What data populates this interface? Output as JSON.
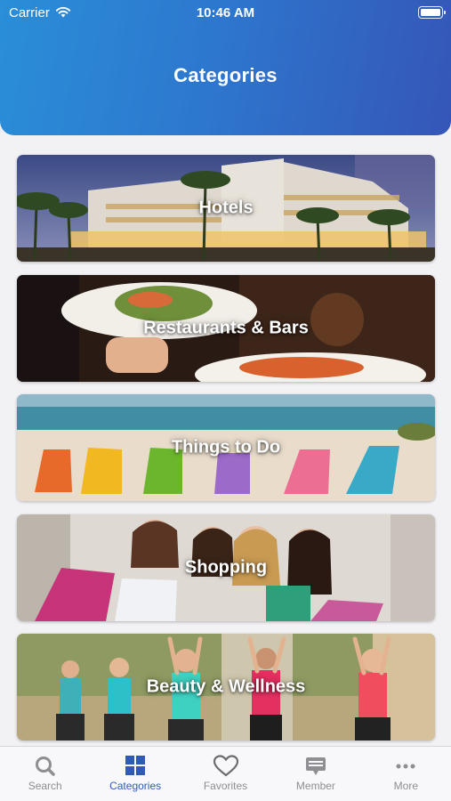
{
  "status_bar": {
    "carrier": "Carrier",
    "time": "10:46 AM"
  },
  "header": {
    "title": "Categories"
  },
  "categories": [
    {
      "label": "Hotels",
      "icon": "hotel-photo"
    },
    {
      "label": "Restaurants & Bars",
      "icon": "restaurant-photo"
    },
    {
      "label": "Things to Do",
      "icon": "beach-chairs-photo"
    },
    {
      "label": "Shopping",
      "icon": "shopping-photo"
    },
    {
      "label": "Beauty & Wellness",
      "icon": "yoga-photo"
    }
  ],
  "tabbar": {
    "items": [
      {
        "label": "Search",
        "icon": "search-icon"
      },
      {
        "label": "Categories",
        "icon": "grid-icon",
        "active": true
      },
      {
        "label": "Favorites",
        "icon": "heart-icon"
      },
      {
        "label": "Member",
        "icon": "member-card-icon"
      },
      {
        "label": "More",
        "icon": "more-dots-icon"
      }
    ]
  },
  "colors": {
    "header_start": "#2a8ed8",
    "header_end": "#3556b8",
    "tab_active": "#2f5bb7",
    "tab_inactive": "#8e8e93"
  }
}
